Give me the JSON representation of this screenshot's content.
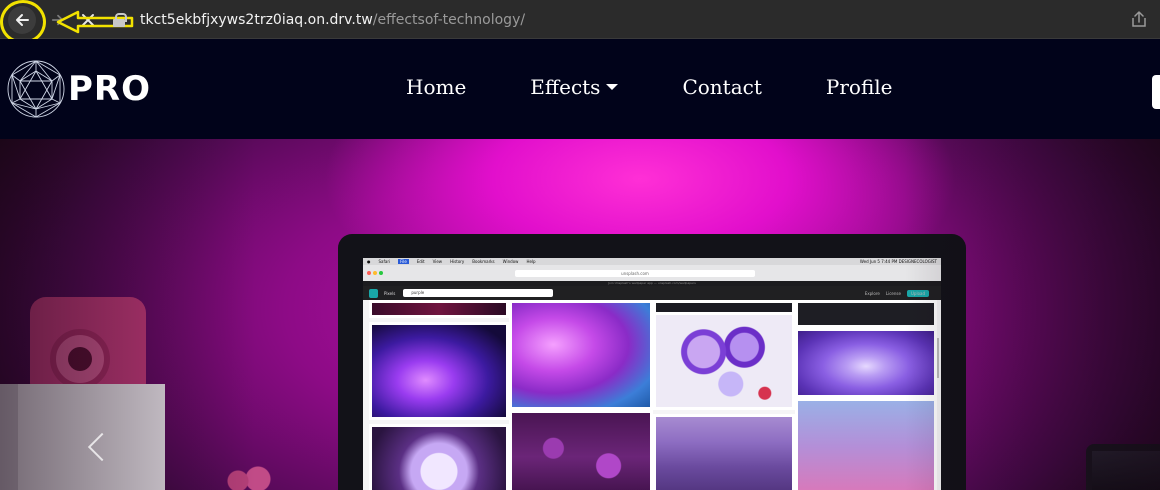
{
  "browser": {
    "url_host": "tkct5ekbfjxyws2trz0iaq.on.drv.tw",
    "url_path": "/effectsof-technology/"
  },
  "site": {
    "logo_text": "PRO",
    "nav": {
      "home": "Home",
      "effects": "Effects",
      "contact": "Contact",
      "profile": "Profile"
    }
  },
  "monitor_screen": {
    "menu": [
      "Safari",
      "File",
      "Edit",
      "View",
      "History",
      "Bookmarks",
      "Window",
      "Help"
    ],
    "clock": "Wed Jun 5  7:44 PM   DESIGNECOLOGIST",
    "address": "unsplash.com",
    "strip_text": "Join Unsplash's wallpaper app — unsplash.com/wallpapers",
    "app_title": "Pixels",
    "search_value": "purple",
    "app_links": [
      "Explore",
      "License"
    ],
    "upload_label": "Upload"
  },
  "colors": {
    "header_bg": "#01031a",
    "hero_glow": "#ff2fd6",
    "annotation": "#f2e200",
    "accent_teal": "#19a7a8"
  }
}
